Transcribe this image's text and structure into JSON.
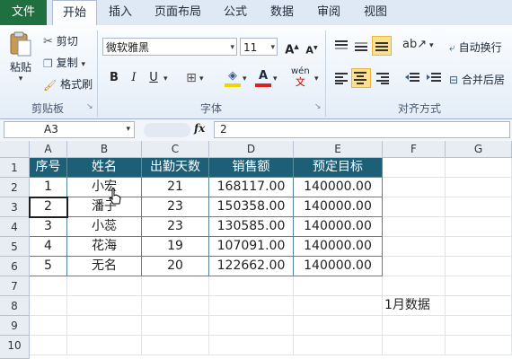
{
  "ribbon_tabs": [
    "文件",
    "开始",
    "插入",
    "页面布局",
    "公式",
    "数据",
    "审阅",
    "视图"
  ],
  "clipboard": {
    "paste": "粘贴",
    "cut": "剪切",
    "copy": "复制",
    "format_painter": "格式刷",
    "group": "剪贴板"
  },
  "font": {
    "name": "微软雅黑",
    "size": "11",
    "group": "字体",
    "bold": "B",
    "italic": "I",
    "underline": "U",
    "grow": "A",
    "shrink": "A",
    "color_a": "A",
    "wen": "wén"
  },
  "alignment": {
    "wrap_text": "自动换行",
    "merge_center": "合并后居",
    "group": "对齐方式"
  },
  "formula_bar": {
    "name_box": "A3",
    "fx": "fx",
    "content": "2"
  },
  "columns": [
    "A",
    "B",
    "C",
    "D",
    "E",
    "F",
    "G"
  ],
  "rows": [
    "1",
    "2",
    "3",
    "4",
    "5",
    "6",
    "7",
    "8",
    "9",
    "10"
  ],
  "table": {
    "headers": [
      "序号",
      "姓名",
      "出勤天数",
      "销售额",
      "预定目标"
    ],
    "rows": [
      [
        "1",
        "小宏",
        "21",
        "168117.00",
        "140000.00"
      ],
      [
        "2",
        "潘子",
        "23",
        "150358.00",
        "140000.00"
      ],
      [
        "3",
        "小蕊",
        "23",
        "130585.00",
        "140000.00"
      ],
      [
        "4",
        "花海",
        "19",
        "107091.00",
        "140000.00"
      ],
      [
        "5",
        "无名",
        "20",
        "122662.00",
        "140000.00"
      ]
    ]
  },
  "note_cell": "1月数据",
  "colors": {
    "file_tab": "#1f6f3f",
    "table_header": "#1d5f77",
    "highlight": "#fbe090"
  }
}
